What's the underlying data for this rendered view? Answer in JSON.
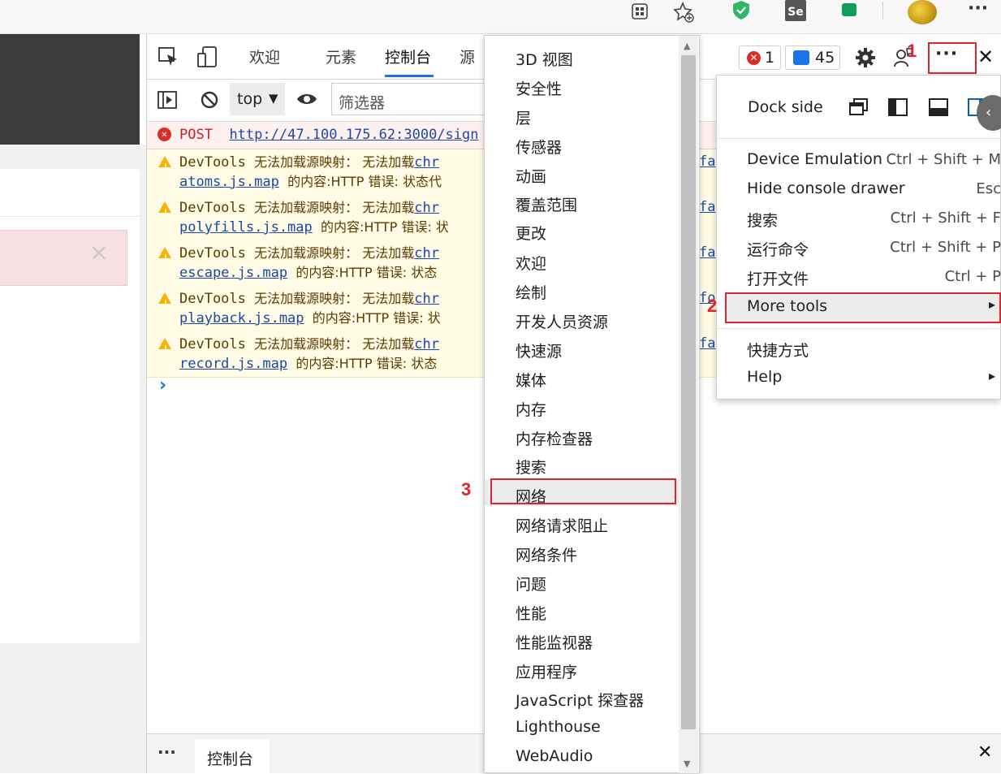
{
  "browser": {
    "profile_icons": [
      "apps-icon",
      "favorites-add-icon",
      "shield-extension-icon",
      "selenium-extension-icon",
      "chat-extension-icon"
    ],
    "more_label": "···"
  },
  "page": {
    "alert_close": "×"
  },
  "devtools": {
    "tabs": [
      "欢迎",
      "元素",
      "控制台",
      "源"
    ],
    "active_tab": "控制台",
    "context_select": "top",
    "filter_placeholder": "筛选器",
    "error_count": "1",
    "message_count": "45",
    "more_label": "···",
    "close_label": "✕"
  },
  "console": {
    "error_row": {
      "method": "POST",
      "url": "http://47.100.175.62:3000/sign"
    },
    "warnings": [
      {
        "prefix": "DevTools",
        "text": "无法加载源映射：  无法加载",
        "link_tail": "chr",
        "file": "atoms.js.map",
        "suffix": "的内容:HTTP 错误: 状态代",
        "right": "fa"
      },
      {
        "prefix": "DevTools",
        "text": "无法加载源映射：  无法加载",
        "link_tail": "chr",
        "file": "polyfills.js.map",
        "suffix": "的内容:HTTP 错误: 状",
        "right": "fa"
      },
      {
        "prefix": "DevTools",
        "text": "无法加载源映射：  无法加载",
        "link_tail": "chr",
        "file": "escape.js.map",
        "suffix": "的内容:HTTP 错误: 状态",
        "right": "fa"
      },
      {
        "prefix": "DevTools",
        "text": "无法加载源映射：  无法加载",
        "link_tail": "chr",
        "file": "playback.js.map",
        "suffix": "的内容:HTTP 错误: 状",
        "right": "fo"
      },
      {
        "prefix": "DevTools",
        "text": "无法加载源映射：  无法加载",
        "link_tail": "chr",
        "file": "record.js.map",
        "suffix": "的内容:HTTP 错误: 状态",
        "right": "fa"
      }
    ],
    "prompt": "›"
  },
  "more_tools_menu": {
    "items": [
      "3D 视图",
      "安全性",
      "层",
      "传感器",
      "动画",
      "覆盖范围",
      "更改",
      "欢迎",
      "绘制",
      "开发人员资源",
      "快速源",
      "媒体",
      "内存",
      "内存检查器",
      "搜索",
      "网络",
      "网络请求阻止",
      "网络条件",
      "问题",
      "性能",
      "性能监视器",
      "应用程序",
      "JavaScript 探查器",
      "Lighthouse",
      "WebAudio"
    ],
    "highlighted": "网络"
  },
  "main_menu": {
    "dock_side_label": "Dock side",
    "items": [
      {
        "label": "Device Emulation",
        "shortcut": "Ctrl + Shift + M"
      },
      {
        "label": "Hide console drawer",
        "shortcut": "Esc"
      },
      {
        "label": "搜索",
        "shortcut": "Ctrl + Shift + F"
      },
      {
        "label": "运行命令",
        "shortcut": "Ctrl + Shift + P"
      },
      {
        "label": "打开文件",
        "shortcut": "Ctrl + P"
      },
      {
        "label": "More tools",
        "shortcut": "▸"
      },
      {
        "label": "快捷方式",
        "shortcut": ""
      },
      {
        "label": "Help",
        "shortcut": "▸"
      }
    ]
  },
  "annotations": {
    "step1": "1",
    "step2": "2",
    "step3": "3"
  },
  "drawer": {
    "more_label": "···",
    "tab": "控制台",
    "close_label": "✕"
  },
  "colors": {
    "accent": "#1a73e8",
    "annotation_red": "#e0232c",
    "warning_bg": "#fffbe5",
    "error_bg": "#fff0f0"
  }
}
